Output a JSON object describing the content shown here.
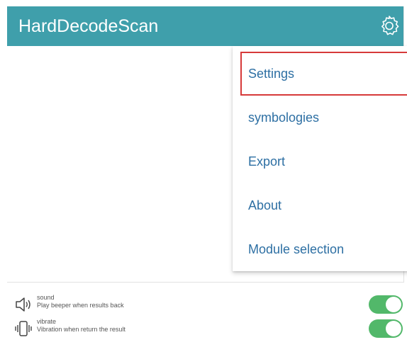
{
  "app_bar": {
    "title": "HardDecodeScan",
    "icon": "gear-icon"
  },
  "menu": {
    "items": [
      {
        "label": "Settings",
        "highlighted": true
      },
      {
        "label": "symbologies"
      },
      {
        "label": "Export"
      },
      {
        "label": "About"
      },
      {
        "label": "Module selection"
      }
    ],
    "highlight_color": "#d63a3a",
    "text_color": "#2d6fa3"
  },
  "settings": [
    {
      "title": "sound",
      "description": "Play beeper when results back",
      "icon": "speaker-icon",
      "enabled": true
    },
    {
      "title": "vibrate",
      "description": "Vibration when return the result",
      "icon": "vibrate-phone-icon",
      "enabled": true
    }
  ],
  "colors": {
    "app_bar": "#3f9fab",
    "toggle_on": "#52b86a"
  }
}
